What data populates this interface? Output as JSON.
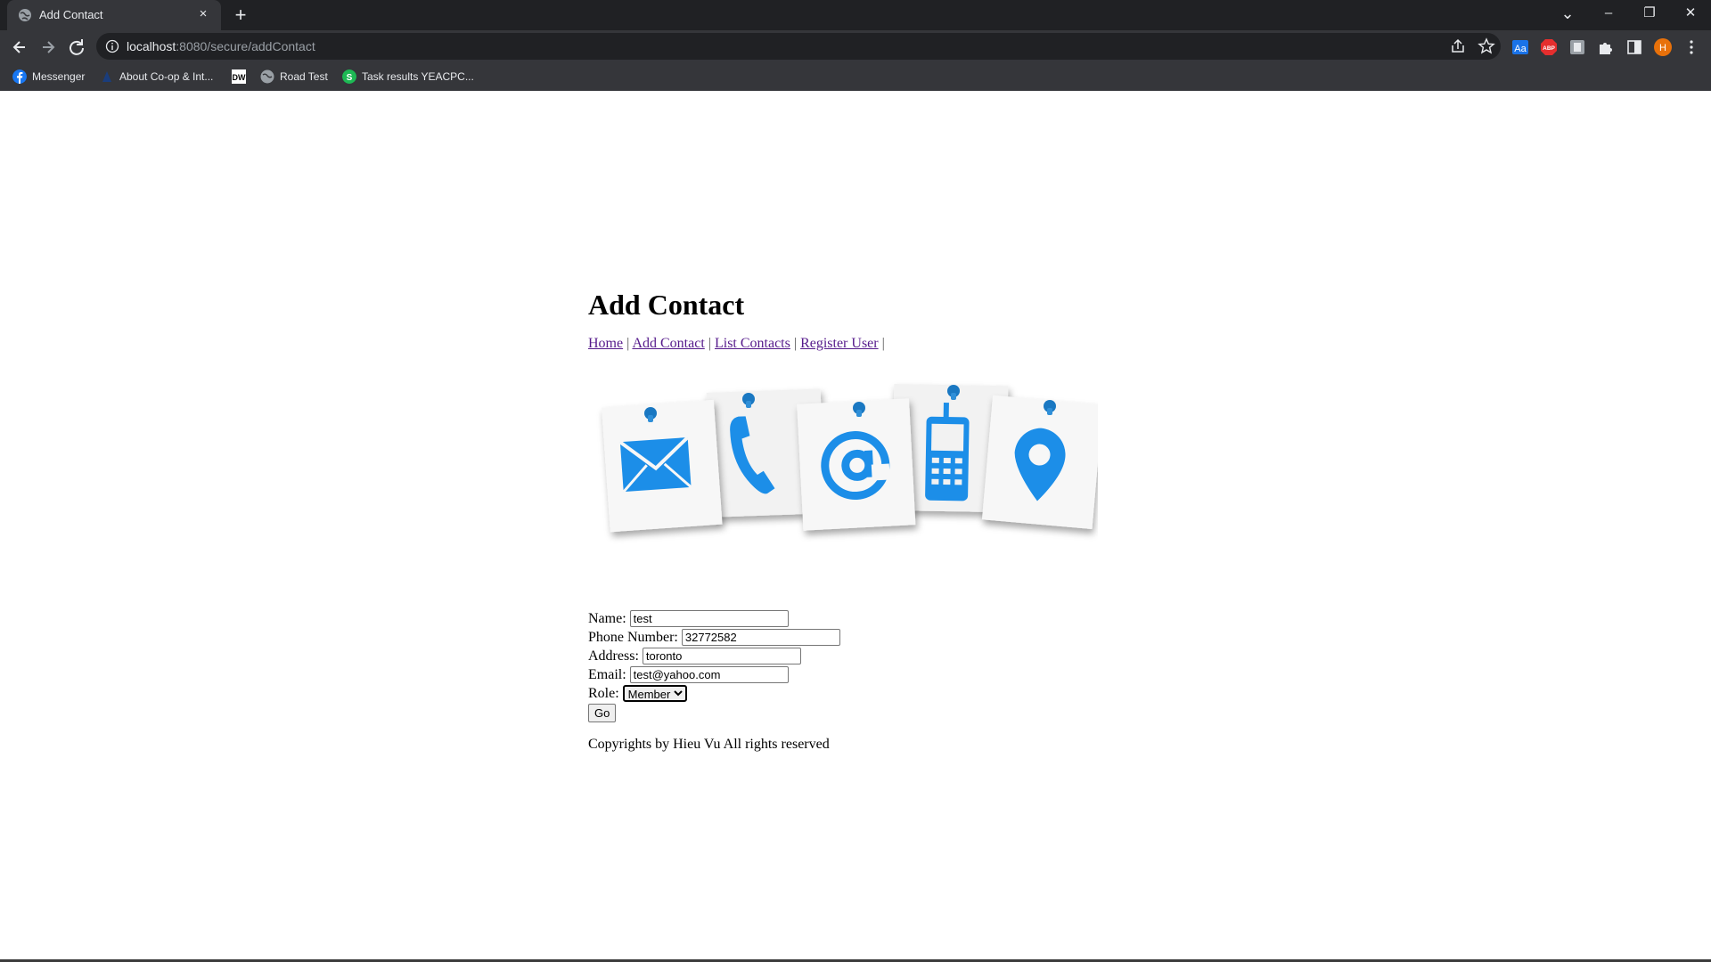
{
  "browser": {
    "tab_title": "Add Contact",
    "tab_close": "×",
    "new_tab": "+",
    "url_host": "localhost",
    "url_rest": ":8080/secure/addContact",
    "profile_initial": "H",
    "window": {
      "tab_search": "⌄",
      "minimize": "–",
      "restore": "❐",
      "close": "✕"
    },
    "bookmarks": [
      {
        "label": "Messenger",
        "icon": "facebook-icon",
        "color": "#1877f2"
      },
      {
        "label": "About Co-op & Int...",
        "icon": "s-icon",
        "color": "#1a3d7c"
      },
      {
        "label": "",
        "icon": "dw-icon",
        "color": "#ffffff"
      },
      {
        "label": "Road Test",
        "icon": "globe-icon",
        "color": "#9aa0a6"
      },
      {
        "label": "Task results YEACPC...",
        "icon": "s-green-icon",
        "color": "#1db954"
      }
    ],
    "extensions": [
      "dictionary-icon",
      "adblock-icon",
      "extension-gray-icon",
      "puzzle-icon",
      "sidepanel-icon"
    ]
  },
  "page": {
    "title": "Add Contact",
    "nav": [
      {
        "label": "Home"
      },
      {
        "label": "Add Contact"
      },
      {
        "label": "List Contacts"
      },
      {
        "label": "Register User"
      }
    ],
    "separator": "|",
    "hero_icons": [
      "envelope-icon",
      "phone-icon",
      "at-icon",
      "mobile-icon",
      "map-pin-icon"
    ],
    "accent_color": "#1c8ee8",
    "form": {
      "name_label": "Name:",
      "name_value": "test",
      "phone_label": "Phone Number:",
      "phone_value": "32772582",
      "address_label": "Address:",
      "address_value": "toronto",
      "email_label": "Email:",
      "email_value": "test@yahoo.com",
      "role_label": "Role:",
      "role_value": "Member",
      "submit_label": "Go"
    },
    "footer": "Copyrights by Hieu Vu All rights reserved"
  }
}
